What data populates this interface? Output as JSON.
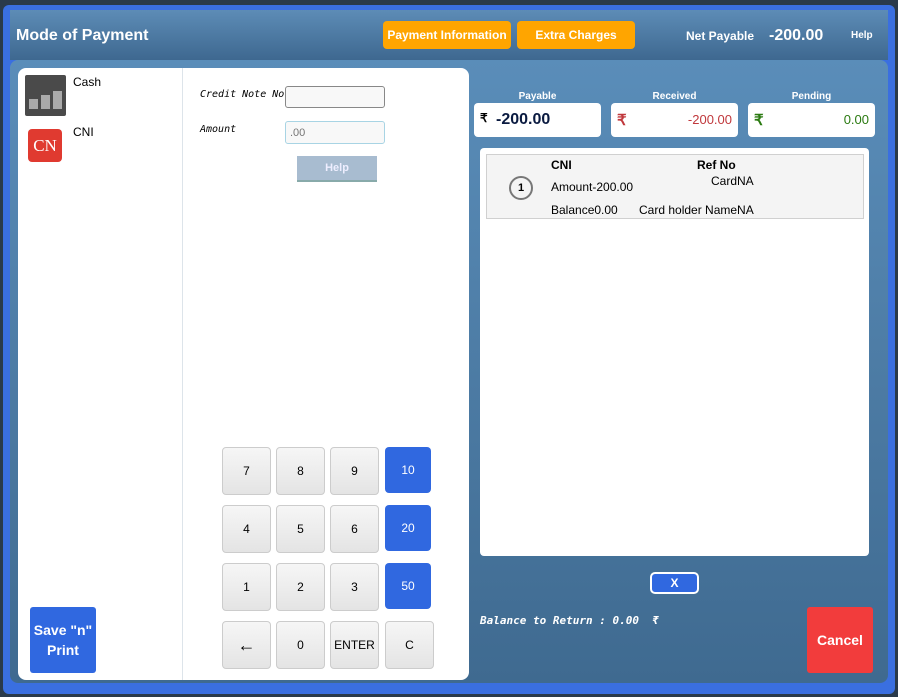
{
  "header": {
    "title": "Mode of Payment",
    "payment_info": "Payment Information",
    "extra_charges": "Extra Charges",
    "net_payable_label": "Net Payable",
    "net_payable_value": "-200.00",
    "help": "Help"
  },
  "sidebar": {
    "items": [
      {
        "label": "Cash",
        "icon": "cash-coins-icon"
      },
      {
        "label": "CNI",
        "icon": "credit-note-icon",
        "icon_text": "CN"
      }
    ],
    "save_print": "Save \"n\" Print"
  },
  "form": {
    "credit_note_label": "Credit Note No",
    "credit_note_value": "",
    "amount_label": "Amount",
    "amount_placeholder": ".00",
    "help_button": "Help"
  },
  "keypad": {
    "keys": [
      "7",
      "8",
      "9",
      "10",
      "4",
      "5",
      "6",
      "20",
      "1",
      "2",
      "3",
      "50",
      "←",
      "0",
      "ENTER",
      "C"
    ]
  },
  "totals": {
    "currency": "₹",
    "payable_label": "Payable",
    "payable": "-200.00",
    "received_label": "Received",
    "received": "-200.00",
    "pending_label": "Pending",
    "pending": "0.00",
    "received_color": "#c0383c",
    "pending_color": "#2a7a10"
  },
  "payments": [
    {
      "index": "1",
      "type": "CNI",
      "amount": "Amount-200.00",
      "balance": "Balance0.00",
      "ref_label": "Ref No",
      "card": "CardNA",
      "holder": "Card holder NameNA"
    }
  ],
  "footer": {
    "remove": "X",
    "balance_return": "Balance to Return : 0.00  ₹",
    "cancel": "Cancel"
  }
}
